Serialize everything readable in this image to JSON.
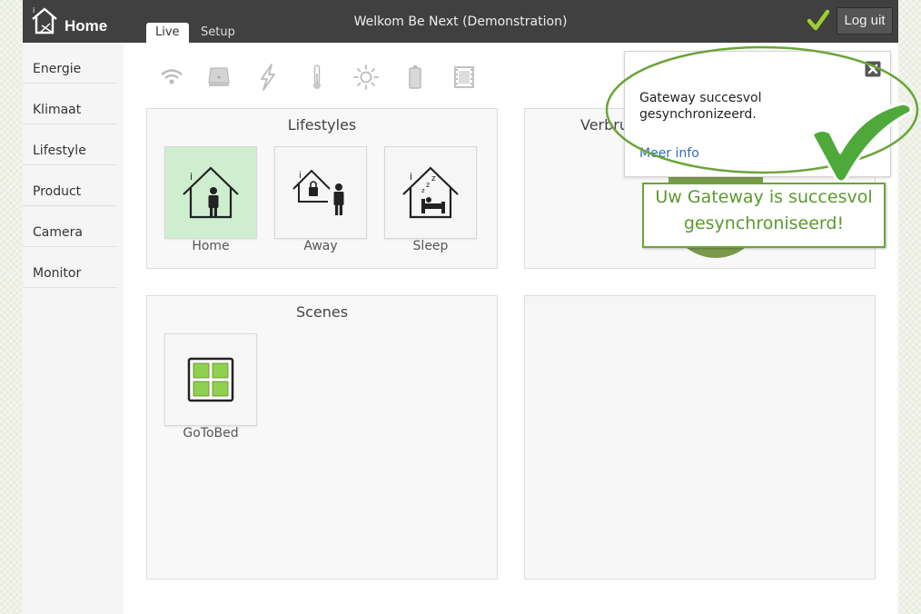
{
  "header": {
    "app_title": "Home",
    "welcome": "Welkom Be Next (Demonstration)",
    "tabs": [
      {
        "label": "Live"
      },
      {
        "label": "Setup"
      }
    ],
    "logout_label": "Log uit"
  },
  "sidebar": {
    "items": [
      {
        "label": "Energie"
      },
      {
        "label": "Klimaat"
      },
      {
        "label": "Lifestyle"
      },
      {
        "label": "Product"
      },
      {
        "label": "Camera"
      },
      {
        "label": "Monitor"
      }
    ]
  },
  "category_icons": [
    "wifi-icon",
    "gateway-icon",
    "lightning-icon",
    "thermometer-icon",
    "sun-icon",
    "battery-icon",
    "film-icon"
  ],
  "lifestyles": {
    "title": "Lifestyles",
    "tiles": [
      {
        "label": "Home",
        "icon": "home-person-icon",
        "active": true
      },
      {
        "label": "Away",
        "icon": "away-lock-icon",
        "active": false
      },
      {
        "label": "Sleep",
        "icon": "sleep-bed-icon",
        "active": false
      }
    ]
  },
  "verbruik": {
    "title_visible": "Verbru"
  },
  "scenes": {
    "title": "Scenes",
    "tiles": [
      {
        "label": "GoToBed",
        "icon": "grid-scene-icon"
      }
    ]
  },
  "notification": {
    "message": "Gateway succesvol gesynchronizeerd.",
    "link": "Meer info"
  },
  "callout": {
    "line1": "Uw Gateway is succesvol",
    "line2": "gesynchroniseerd!"
  },
  "colors": {
    "topbar": "#404040",
    "accent_green": "#6aa539",
    "active_tile": "#cfeecf",
    "link": "#2e6db5"
  }
}
